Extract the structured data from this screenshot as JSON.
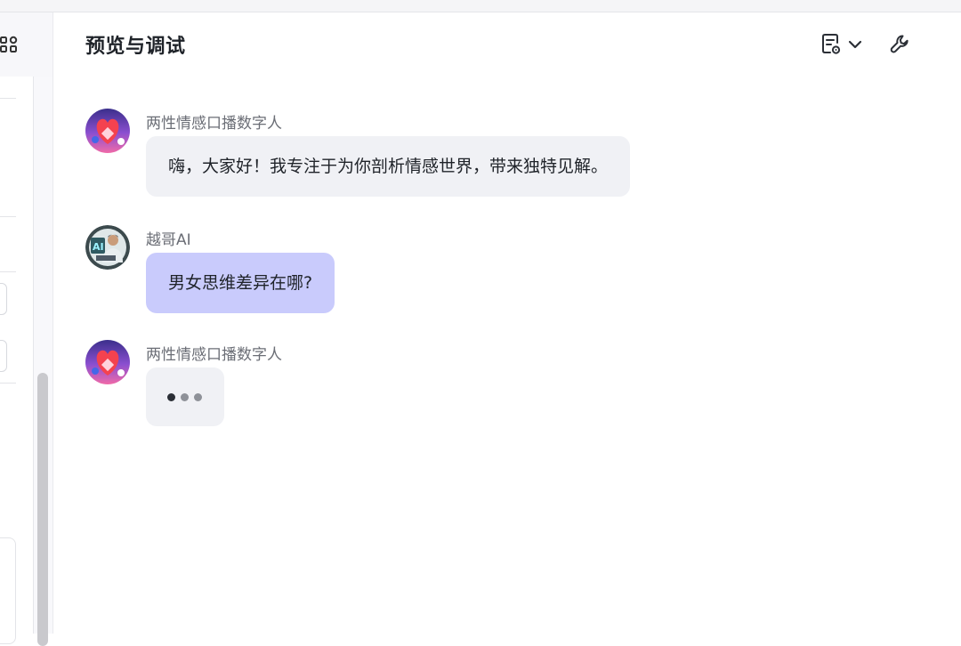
{
  "header": {
    "title": "预览与调试",
    "icons": [
      "document-settings-icon",
      "chevron-down-icon",
      "wrench-icon"
    ]
  },
  "left_panel": {
    "icons": [
      "grid-icon"
    ]
  },
  "messages": [
    {
      "role": "bot",
      "sender": "两性情感口播数字人",
      "text": "嗨，大家好！我专注于为你剖析情感世界，带来独特见解。",
      "avatar": "heart-avatar-icon"
    },
    {
      "role": "user",
      "sender": "越哥AI",
      "text": "男女思维差异在哪?",
      "avatar": "user-avatar-icon"
    },
    {
      "role": "bot",
      "sender": "两性情感口播数字人",
      "status": "typing",
      "avatar": "heart-avatar-icon"
    }
  ],
  "colors": {
    "bot_bubble": "#f0f1f5",
    "user_bubble": "#c9cbfc",
    "sender_text": "#6b6e76"
  }
}
